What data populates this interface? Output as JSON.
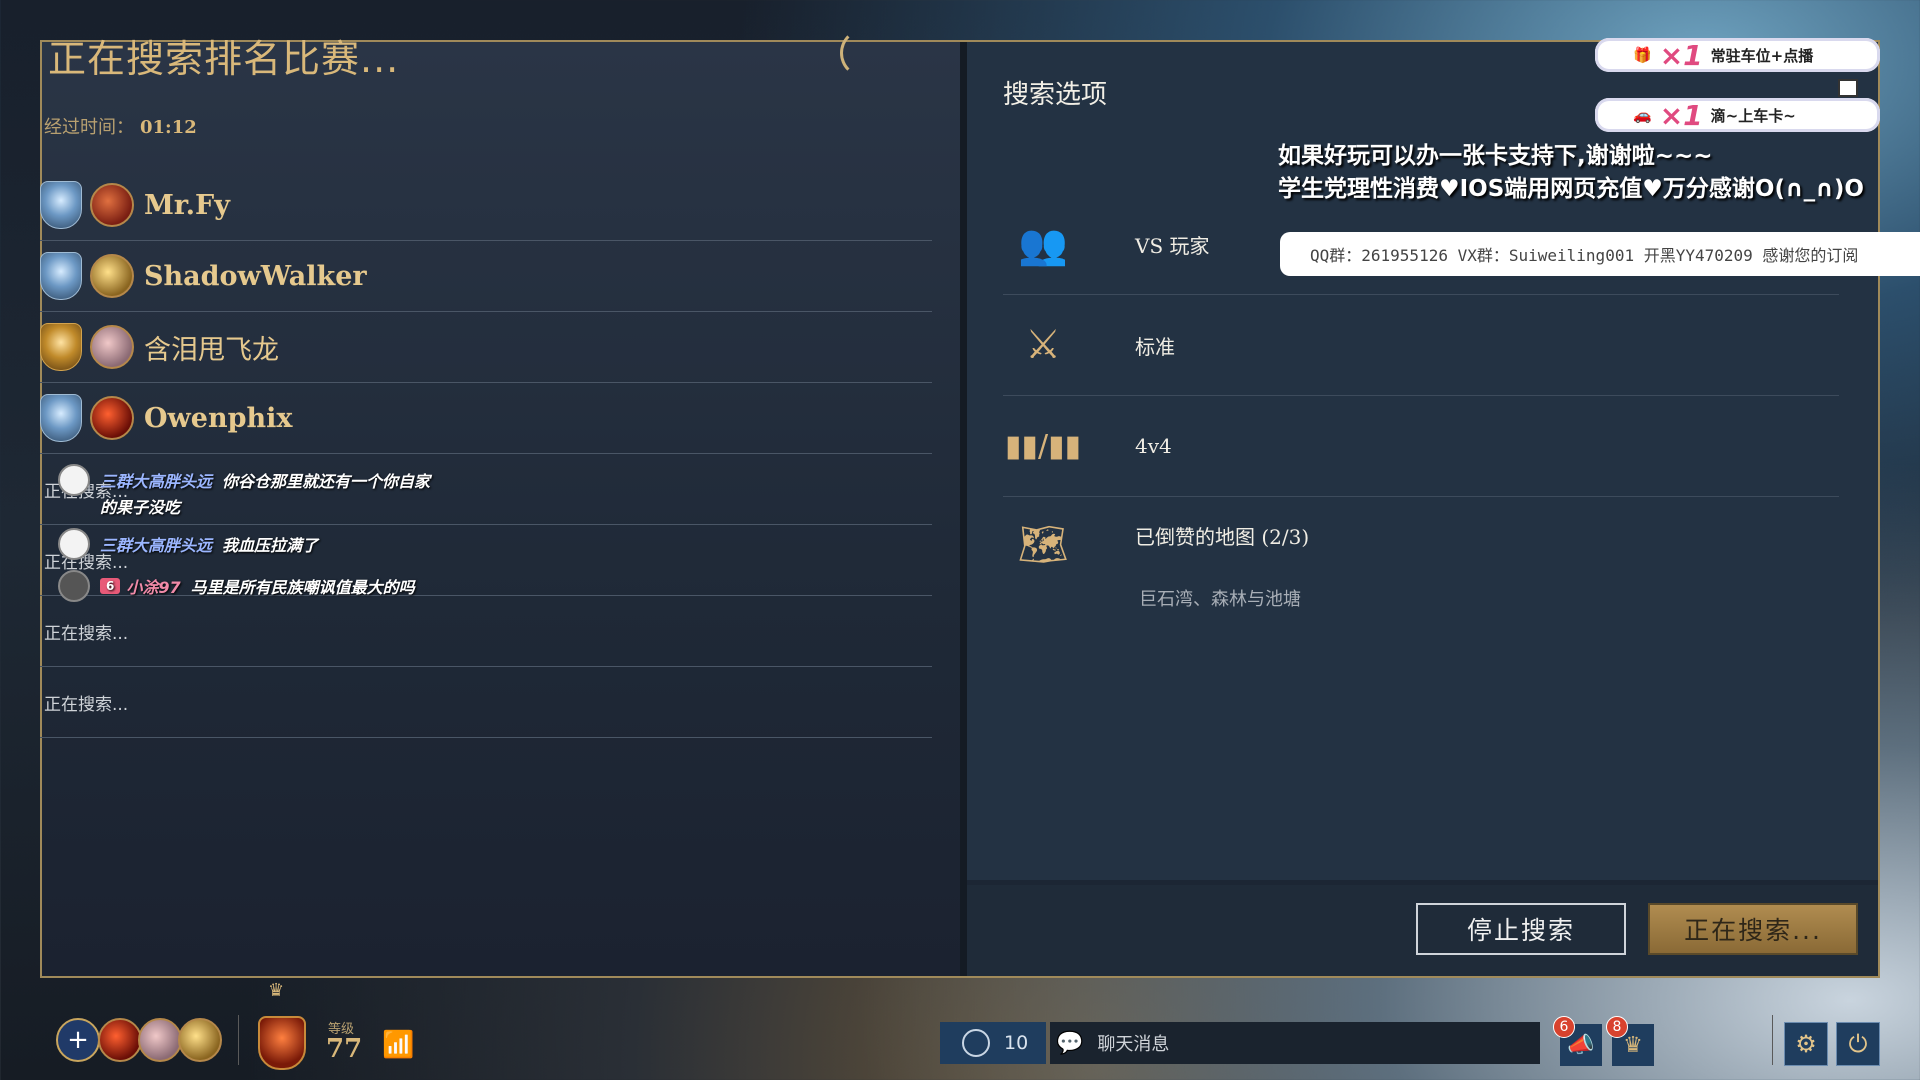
{
  "search": {
    "title": "正在搜索排名比赛...",
    "elapsed_label": "经过时间：",
    "elapsed_value": "01:12"
  },
  "players": [
    {
      "name": "Mr.Fy",
      "rank": "blue",
      "avatar": "red"
    },
    {
      "name": "ShadowWalker",
      "rank": "blue",
      "avatar": "gold"
    },
    {
      "name": "含泪甩飞龙",
      "rank": "gold",
      "avatar": "pink"
    },
    {
      "name": "Owenphix",
      "rank": "blue",
      "avatar": "fire"
    }
  ],
  "searching_slots": [
    "正在搜索...",
    "正在搜索...",
    "正在搜索...",
    "正在搜索..."
  ],
  "danmaku": [
    {
      "user": "三群大高胖头远",
      "text": "你谷仓那里就还有一个你自家"
    },
    {
      "user": "",
      "text": "的果子没吃"
    },
    {
      "user": "三群大高胖头远",
      "text": "我血压拉满了"
    },
    {
      "user": "小涂97",
      "badge": "6",
      "text": "马里是所有民族嘲讽值最大的吗"
    }
  ],
  "options": {
    "title": "搜索选项",
    "rows": [
      {
        "icon": "players-icon",
        "label": "VS 玩家"
      },
      {
        "icon": "crossed-swords-icon",
        "label": "标准"
      },
      {
        "icon": "team-size-icon",
        "label": "4v4"
      },
      {
        "icon": "map-icon",
        "label": "已倒赞的地图 (2/3)",
        "sub": "巨石湾、森林与池塘"
      }
    ]
  },
  "buttons": {
    "stop": "停止搜索",
    "searching": "正在搜索..."
  },
  "stream": {
    "overlay1": {
      "mult": "×1",
      "text": "常驻车位+点播"
    },
    "overlay2": {
      "mult": "×1",
      "text": "滴~上车卡~"
    },
    "line1": "如果好玩可以办一张卡支持下,谢谢啦~~~",
    "line2": "学生党理性消费♥IOS端用网页充值♥万分感谢O(∩_∩)O",
    "qq": "QQ群：261955126 VX群：Suiweiling001 开黑YY470209 感谢您的订阅"
  },
  "bottom": {
    "level_label": "等级",
    "level_value": "77",
    "friends_count": "10",
    "chat_placeholder": "聊天消息",
    "notif1": "6",
    "notif2": "8"
  },
  "colors": {
    "gold_accent": "#d9b87a",
    "panel_dark": "#1f2937",
    "button_gold": "#b08c50"
  }
}
